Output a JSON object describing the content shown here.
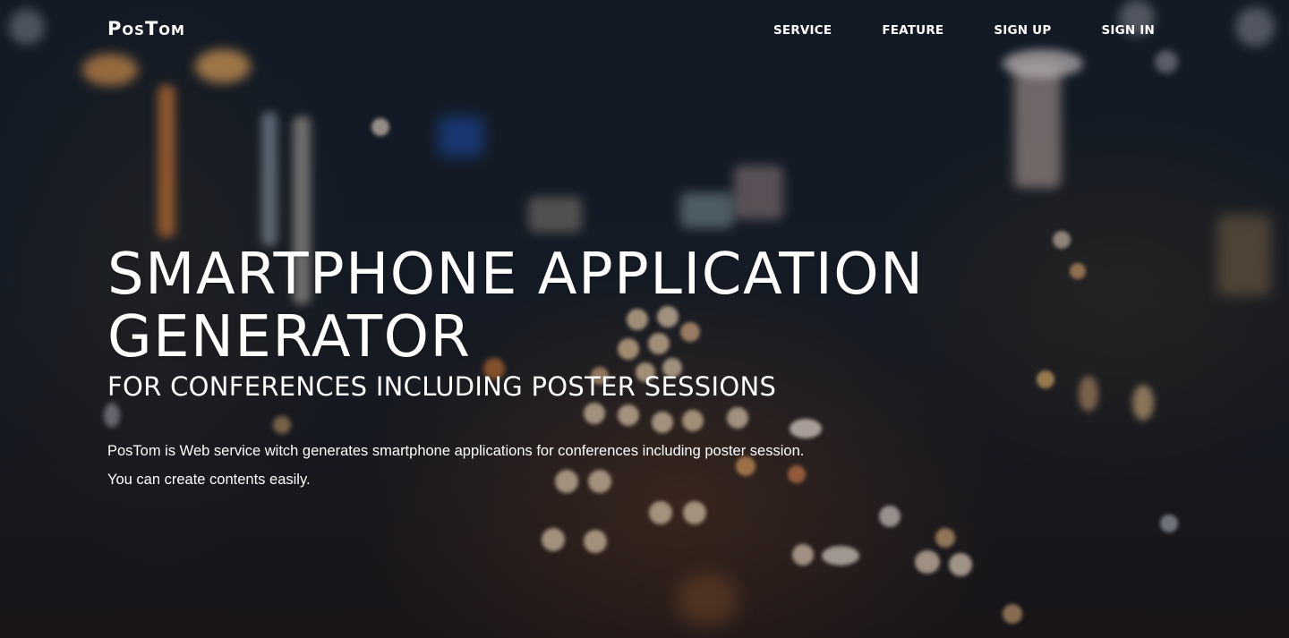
{
  "brand": {
    "logo_text": "PosTom"
  },
  "nav": {
    "items": [
      {
        "label": "SERVICE"
      },
      {
        "label": "FEATURE"
      },
      {
        "label": "SIGN UP"
      },
      {
        "label": "SIGN IN"
      }
    ]
  },
  "hero": {
    "title_line1": "SMARTPHONE APPLICATION",
    "title_line2": "GENERATOR",
    "subtitle": "FOR CONFERENCES INCLUDING POSTER SESSIONS",
    "description_line1": "PosTom is Web service witch generates smartphone applications for conferences including poster session.",
    "description_line2": "You can create contents easily.",
    "background": "blurred-night-city-traffic-photo"
  },
  "colors": {
    "text": "#ffffff",
    "background_dark": "#141c26",
    "accent_warm": "#f2b46a"
  }
}
